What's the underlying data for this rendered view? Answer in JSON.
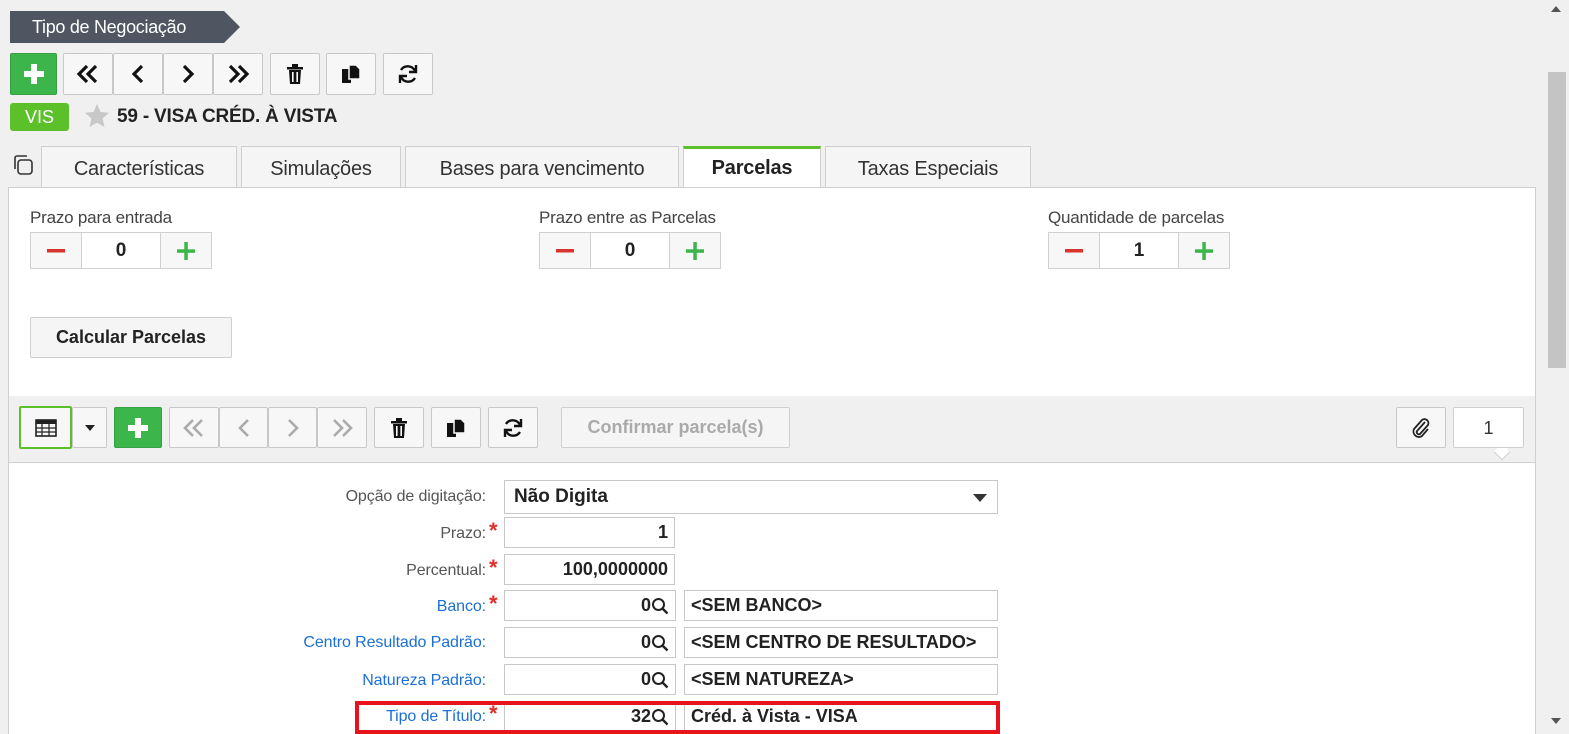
{
  "breadcrumb": "Tipo de Negociação",
  "record": {
    "badge": "VIS",
    "title": "59 - VISA CRÉD. À VISTA"
  },
  "tabs": [
    {
      "label": "Características",
      "active": false
    },
    {
      "label": "Simulações",
      "active": false
    },
    {
      "label": "Bases para vencimento",
      "active": false
    },
    {
      "label": "Parcelas",
      "active": true
    },
    {
      "label": "Taxas Especiais",
      "active": false
    }
  ],
  "parcelas": {
    "prazo_entrada": {
      "label": "Prazo para entrada",
      "value": "0"
    },
    "prazo_entre": {
      "label": "Prazo entre as Parcelas",
      "value": "0"
    },
    "quantidade": {
      "label": "Quantidade de parcelas",
      "value": "1"
    },
    "calc_button": "Calcular Parcelas"
  },
  "subtoolbar": {
    "confirm_label": "Confirmar parcela(s)",
    "count": "1"
  },
  "form": {
    "opcao": {
      "label": "Opção de digitação:",
      "value": "Não Digita"
    },
    "prazo": {
      "label": "Prazo:",
      "value": "1"
    },
    "percentual": {
      "label": "Percentual:",
      "value": "100,0000000"
    },
    "banco": {
      "label": "Banco:",
      "code": "0",
      "desc": "<SEM BANCO>"
    },
    "centro": {
      "label": "Centro Resultado Padrão:",
      "code": "0",
      "desc": "<SEM CENTRO DE RESULTADO>"
    },
    "natureza": {
      "label": "Natureza Padrão:",
      "code": "0",
      "desc": "<SEM NATUREZA>"
    },
    "tipo_titulo": {
      "label": "Tipo de Título:",
      "code": "32",
      "desc": "Créd. à Vista - VISA"
    }
  },
  "colors": {
    "accent_green": "#3cb54a",
    "badge_green": "#5cc02a",
    "link_blue": "#1c6fd4",
    "required_red": "#e0302a",
    "highlight_red": "#e8141b"
  }
}
